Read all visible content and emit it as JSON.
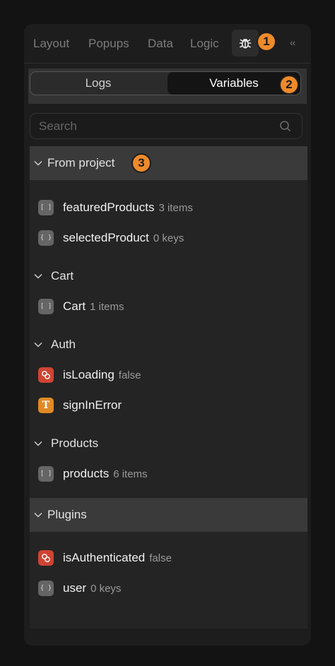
{
  "topnav": {
    "tabs": [
      "Layout",
      "Popups",
      "Data",
      "Logic"
    ],
    "collapse_label": "‹‹",
    "debug_icon": "bug-icon"
  },
  "badges": [
    "1",
    "2",
    "3"
  ],
  "segment": {
    "logs_label": "Logs",
    "variables_label": "Variables",
    "selected": "Variables"
  },
  "search": {
    "placeholder": "Search",
    "value": ""
  },
  "groups": [
    {
      "label": "From project",
      "items": [
        {
          "name": "featuredProducts",
          "meta": "3 items",
          "type": "array"
        },
        {
          "name": "selectedProduct",
          "meta": "0 keys",
          "type": "object"
        }
      ]
    },
    {
      "label": "Cart",
      "items": [
        {
          "name": "Cart",
          "meta": "1 items",
          "type": "array"
        }
      ]
    },
    {
      "label": "Auth",
      "items": [
        {
          "name": "isLoading",
          "meta": "false",
          "type": "boolean"
        },
        {
          "name": "signInError",
          "meta": "",
          "type": "text"
        }
      ]
    },
    {
      "label": "Products",
      "items": [
        {
          "name": "products",
          "meta": "6 items",
          "type": "array"
        }
      ]
    },
    {
      "label": "Plugins",
      "items": [
        {
          "name": "isAuthenticated",
          "meta": "false",
          "type": "boolean"
        },
        {
          "name": "user",
          "meta": "0 keys",
          "type": "object"
        }
      ]
    }
  ],
  "colors": {
    "accent": "#ee8a2a",
    "boolean_icon": "#cf4433",
    "text_icon": "#e08a25"
  }
}
